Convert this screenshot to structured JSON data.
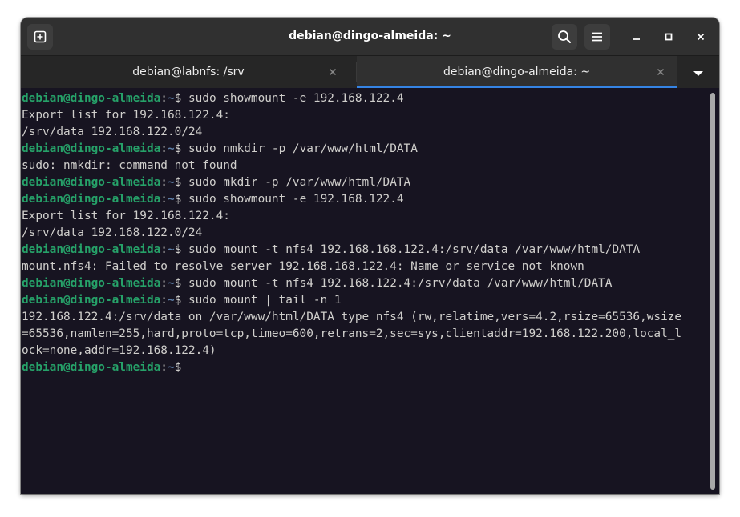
{
  "window": {
    "title": "debian@dingo-almeida: ~"
  },
  "headerbar": {
    "icons": [
      "new-tab-icon",
      "search-icon",
      "hamburger-menu-icon",
      "minimize-icon",
      "maximize-icon",
      "close-icon"
    ]
  },
  "tabs": [
    {
      "label": "debian@labnfs: /srv",
      "active": false
    },
    {
      "label": "debian@dingo-almeida: ~",
      "active": true
    }
  ],
  "colors": {
    "terminal_bg": "#171421",
    "terminal_fg": "#d0cfcc",
    "prompt_user": "#26a269",
    "prompt_path": "#5e7fa8",
    "accent": "#3584e4"
  },
  "terminal": {
    "lines": [
      {
        "type": "prompt",
        "user": "debian@dingo-almeida",
        "sep": ":",
        "path": "~",
        "sym": "$ ",
        "cmd": "sudo showmount -e 192.168.122.4"
      },
      {
        "type": "out",
        "text": "Export list for 192.168.122.4:"
      },
      {
        "type": "out",
        "text": "/srv/data 192.168.122.0/24"
      },
      {
        "type": "prompt",
        "user": "debian@dingo-almeida",
        "sep": ":",
        "path": "~",
        "sym": "$ ",
        "cmd": "sudo nmkdir -p /var/www/html/DATA"
      },
      {
        "type": "out",
        "text": "sudo: nmkdir: command not found"
      },
      {
        "type": "prompt",
        "user": "debian@dingo-almeida",
        "sep": ":",
        "path": "~",
        "sym": "$ ",
        "cmd": "sudo mkdir -p /var/www/html/DATA"
      },
      {
        "type": "prompt",
        "user": "debian@dingo-almeida",
        "sep": ":",
        "path": "~",
        "sym": "$ ",
        "cmd": "sudo showmount -e 192.168.122.4"
      },
      {
        "type": "out",
        "text": "Export list for 192.168.122.4:"
      },
      {
        "type": "out",
        "text": "/srv/data 192.168.122.0/24"
      },
      {
        "type": "prompt",
        "user": "debian@dingo-almeida",
        "sep": ":",
        "path": "~",
        "sym": "$ ",
        "cmd": "sudo mount -t nfs4 192.168.168.122.4:/srv/data /var/www/html/DATA"
      },
      {
        "type": "out",
        "text": "mount.nfs4: Failed to resolve server 192.168.168.122.4: Name or service not known"
      },
      {
        "type": "prompt",
        "user": "debian@dingo-almeida",
        "sep": ":",
        "path": "~",
        "sym": "$ ",
        "cmd": "sudo mount -t nfs4 192.168.122.4:/srv/data /var/www/html/DATA"
      },
      {
        "type": "prompt",
        "user": "debian@dingo-almeida",
        "sep": ":",
        "path": "~",
        "sym": "$ ",
        "cmd": "sudo mount | tail -n 1"
      },
      {
        "type": "out",
        "text": "192.168.122.4:/srv/data on /var/www/html/DATA type nfs4 (rw,relatime,vers=4.2,rsize=65536,wsize"
      },
      {
        "type": "out",
        "text": "=65536,namlen=255,hard,proto=tcp,timeo=600,retrans=2,sec=sys,clientaddr=192.168.122.200,local_l"
      },
      {
        "type": "out",
        "text": "ock=none,addr=192.168.122.4)"
      },
      {
        "type": "prompt",
        "user": "debian@dingo-almeida",
        "sep": ":",
        "path": "~",
        "sym": "$",
        "cmd": ""
      }
    ]
  }
}
